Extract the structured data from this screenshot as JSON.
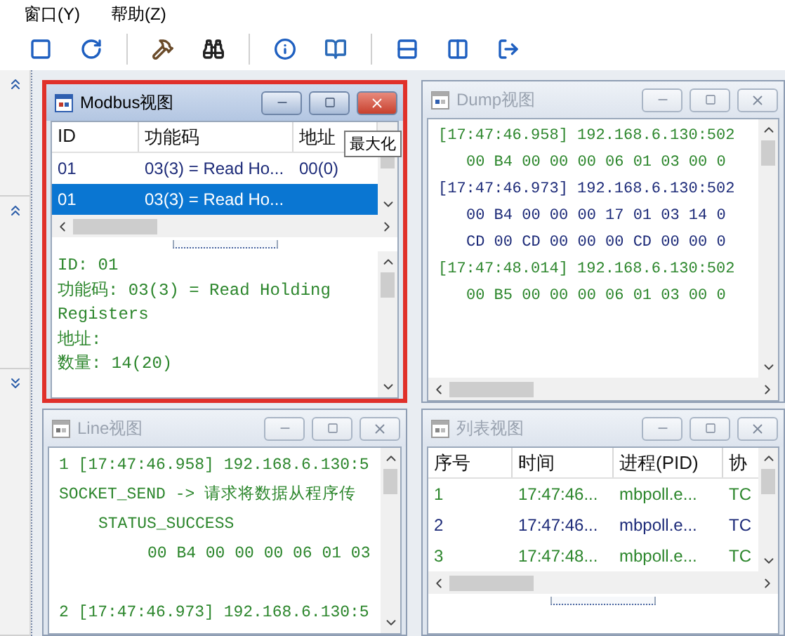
{
  "menu": [
    {
      "label": "窗口(Y)"
    },
    {
      "label": "帮助(Z)"
    }
  ],
  "toolbar": [
    {
      "kind": "stop"
    },
    {
      "kind": "refresh"
    },
    {
      "kind": "sep"
    },
    {
      "kind": "hammer"
    },
    {
      "kind": "binoculars"
    },
    {
      "kind": "sep"
    },
    {
      "kind": "info"
    },
    {
      "kind": "book"
    },
    {
      "kind": "sep"
    },
    {
      "kind": "split-h"
    },
    {
      "kind": "split-v"
    },
    {
      "kind": "exit"
    }
  ],
  "sidebar": [
    {
      "kind": "collapse"
    },
    {
      "kind": "collapse"
    },
    {
      "kind": "expand"
    }
  ],
  "modbus_view": {
    "title": "Modbus视图",
    "active": true,
    "highlighted": true,
    "tooltip": "最大化",
    "columns": [
      "ID",
      "功能码",
      "地址"
    ],
    "rows": [
      {
        "cells": [
          "01",
          "03(3) = Read Ho...",
          "00(0)"
        ],
        "selected": false
      },
      {
        "cells": [
          "01",
          "03(3) = Read Ho..."
        ],
        "selected": true
      }
    ],
    "details": [
      "ID:  01",
      "功能码: 03(3) = Read Holding Registers",
      "地址:",
      "数量: 14(20)"
    ]
  },
  "dump_view": {
    "title": "Dump视图",
    "active": false,
    "entries": [
      {
        "color": "#2c862c",
        "header": "[17:47:46.958] 192.168.6.130:502",
        "bytes": [
          "00 B4 00 00 00 06 01 03 00 0"
        ]
      },
      {
        "color": "#1c2a78",
        "header": "[17:47:46.973] 192.168.6.130:502",
        "bytes": [
          "00 B4 00 00 00 17 01 03 14 0",
          "CD 00 CD 00 00 00 CD 00 00 0"
        ]
      },
      {
        "color": "#2c862c",
        "header": "[17:47:48.014] 192.168.6.130:502",
        "bytes": [
          "00 B5 00 00 00 06 01 03 00 0"
        ]
      }
    ]
  },
  "line_view": {
    "title": "Line视图",
    "active": false,
    "entries": [
      {
        "header": "1 [17:47:46.958] 192.168.6.130:5",
        "event": "SOCKET_SEND -> 请求将数据从程序传",
        "status": "STATUS_SUCCESS",
        "data": [
          "00 B4 00 00 00 06 01 03"
        ]
      },
      {
        "header": "2 [17:47:46.973] 192.168.6.130:5"
      }
    ]
  },
  "list_view": {
    "title": "列表视图",
    "active": false,
    "columns": [
      "序号",
      "时间",
      "进程(PID)",
      "协"
    ],
    "rows": [
      {
        "color": "#2c862c",
        "cells": [
          "1",
          "17:47:46...",
          "mbpoll.e...",
          "TC"
        ]
      },
      {
        "color": "#1c2a78",
        "cells": [
          "2",
          "17:47:46...",
          "mbpoll.e...",
          "TC"
        ]
      },
      {
        "color": "#2c862c",
        "cells": [
          "3",
          "17:47:48...",
          "mbpoll.e...",
          "TC"
        ]
      }
    ]
  }
}
